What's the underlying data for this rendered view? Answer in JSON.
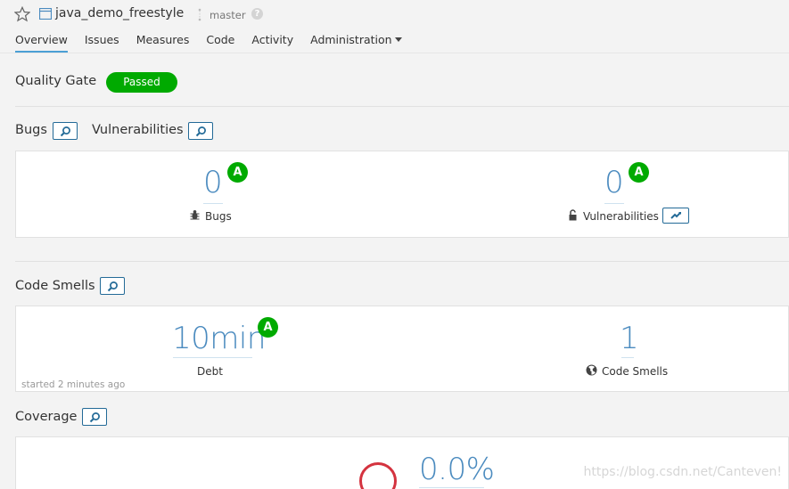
{
  "header": {
    "project_name": "java_demo_freestyle",
    "branch": "master",
    "help": "?",
    "nav": [
      {
        "label": "Overview"
      },
      {
        "label": "Issues"
      },
      {
        "label": "Measures"
      },
      {
        "label": "Code"
      },
      {
        "label": "Activity"
      },
      {
        "label": "Administration"
      }
    ]
  },
  "quality_gate": {
    "label": "Quality Gate",
    "status": "Passed"
  },
  "bugs_vulns": {
    "bugs_title": "Bugs",
    "vulns_title": "Vulnerabilities",
    "bugs": {
      "value": "0",
      "rating": "A",
      "label": "Bugs"
    },
    "vulnerabilities": {
      "value": "0",
      "rating": "A",
      "label": "Vulnerabilities"
    }
  },
  "code_smells": {
    "title": "Code Smells",
    "debt": {
      "value": "10min",
      "rating": "A",
      "label": "Debt"
    },
    "smells": {
      "value": "1",
      "label": "Code Smells"
    },
    "started": "started 2 minutes ago"
  },
  "coverage": {
    "title": "Coverage",
    "value": "0.0%"
  },
  "watermark": "https://blog.csdn.net/Canteven!"
}
